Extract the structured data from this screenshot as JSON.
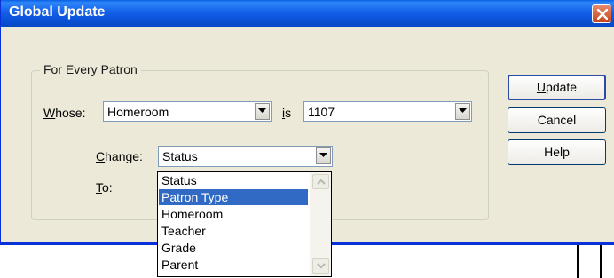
{
  "window": {
    "title": "Global Update"
  },
  "group": {
    "legend": "For Every Patron"
  },
  "whose": {
    "label_u": "W",
    "label_rest": "hose:",
    "value": "Homeroom"
  },
  "is": {
    "label_u": "i",
    "label_rest": "s",
    "value": "1107"
  },
  "change": {
    "label_u": "C",
    "label_rest": "hange:",
    "value": "Status"
  },
  "to": {
    "label_u": "T",
    "label_rest": "o:"
  },
  "buttons": {
    "update_u": "U",
    "update_rest": "pdate",
    "cancel": "Cancel",
    "help": "Help"
  },
  "dropdown": {
    "options": [
      "Status",
      "Patron Type",
      "Homeroom",
      "Teacher",
      "Grade",
      "Parent"
    ],
    "selected_index": 1
  },
  "colors": {
    "selection": "#316ac5",
    "titlebar": "#0a52d8"
  },
  "icons": {
    "close": "close-icon",
    "combo_arrow": "chevron-down-icon"
  }
}
